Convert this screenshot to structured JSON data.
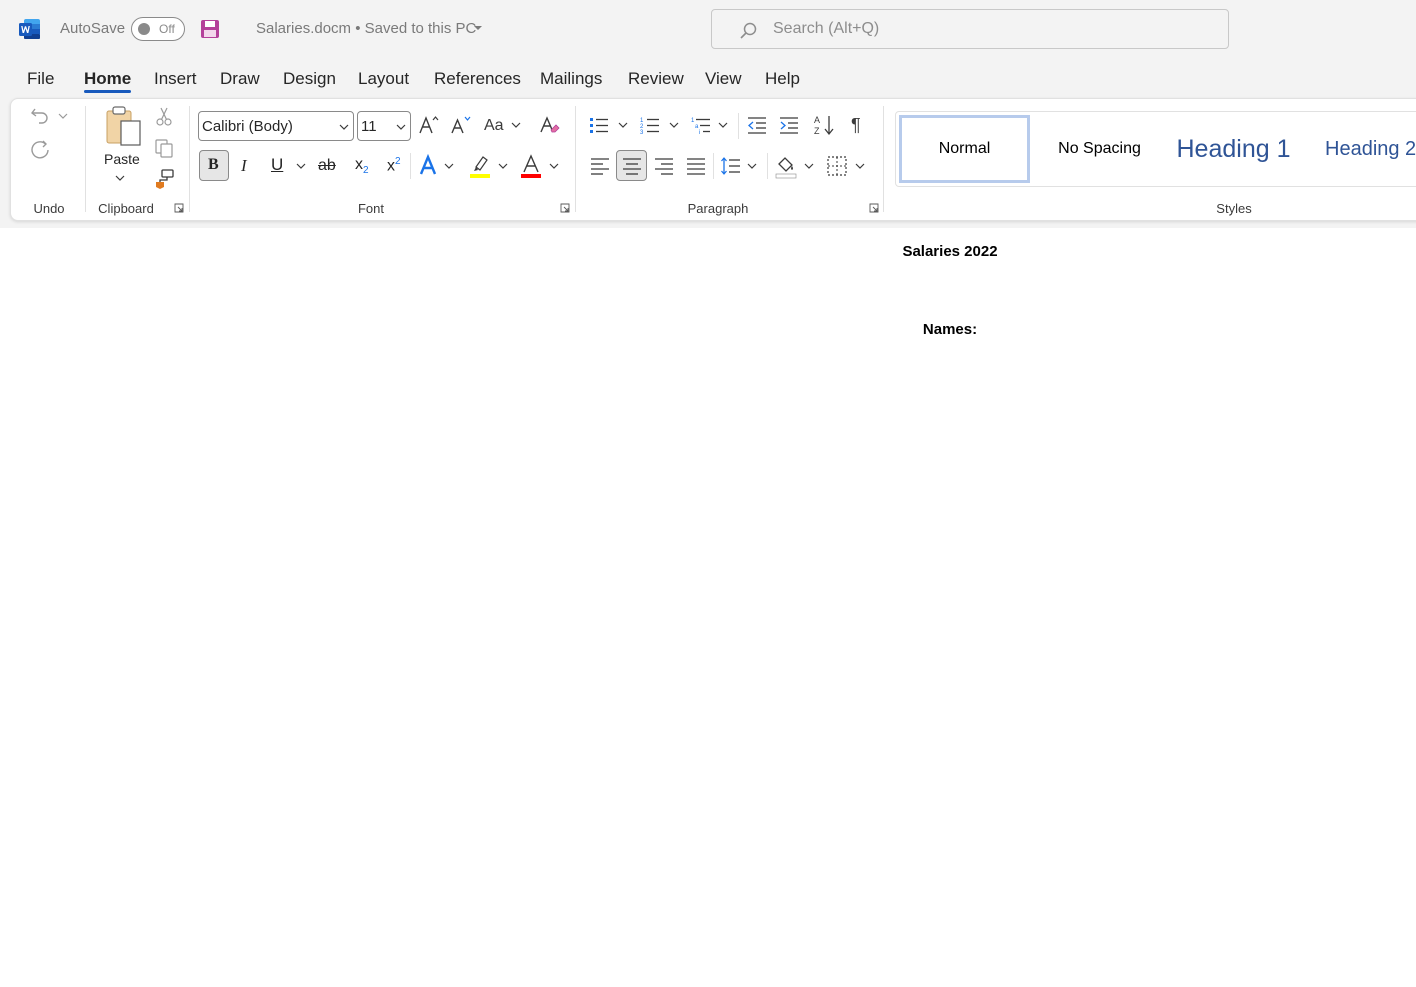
{
  "window": {
    "autosave_label": "AutoSave",
    "autosave_state": "Off",
    "document_title": "Salaries.docm • Saved to this PC",
    "search_placeholder": "Search (Alt+Q)"
  },
  "tabs": [
    "File",
    "Home",
    "Insert",
    "Draw",
    "Design",
    "Layout",
    "References",
    "Mailings",
    "Review",
    "View",
    "Help"
  ],
  "active_tab": "Home",
  "ribbon": {
    "groups": {
      "undo": "Undo",
      "clipboard": "Clipboard",
      "font": "Font",
      "paragraph": "Paragraph",
      "styles": "Styles"
    },
    "paste_label": "Paste",
    "font_name": "Calibri (Body)",
    "font_size": "11",
    "change_case_label": "Aa",
    "bold_label": "B",
    "italic_label": "I",
    "underline_label": "U",
    "strike_label": "ab",
    "sub_label": "x",
    "sup_label": "x",
    "styles": [
      "Normal",
      "No Spacing",
      "Heading 1",
      "Heading 2"
    ],
    "selected_style": "Normal"
  },
  "document": {
    "title": "Salaries 2022",
    "line2": "Names:"
  },
  "colors": {
    "accent": "#185abd",
    "word_blue": "#185abd",
    "save_purple": "#b4409a",
    "highlight_yellow": "#ffff00",
    "font_red": "#ff0000",
    "heading_blue": "#2f5496"
  }
}
